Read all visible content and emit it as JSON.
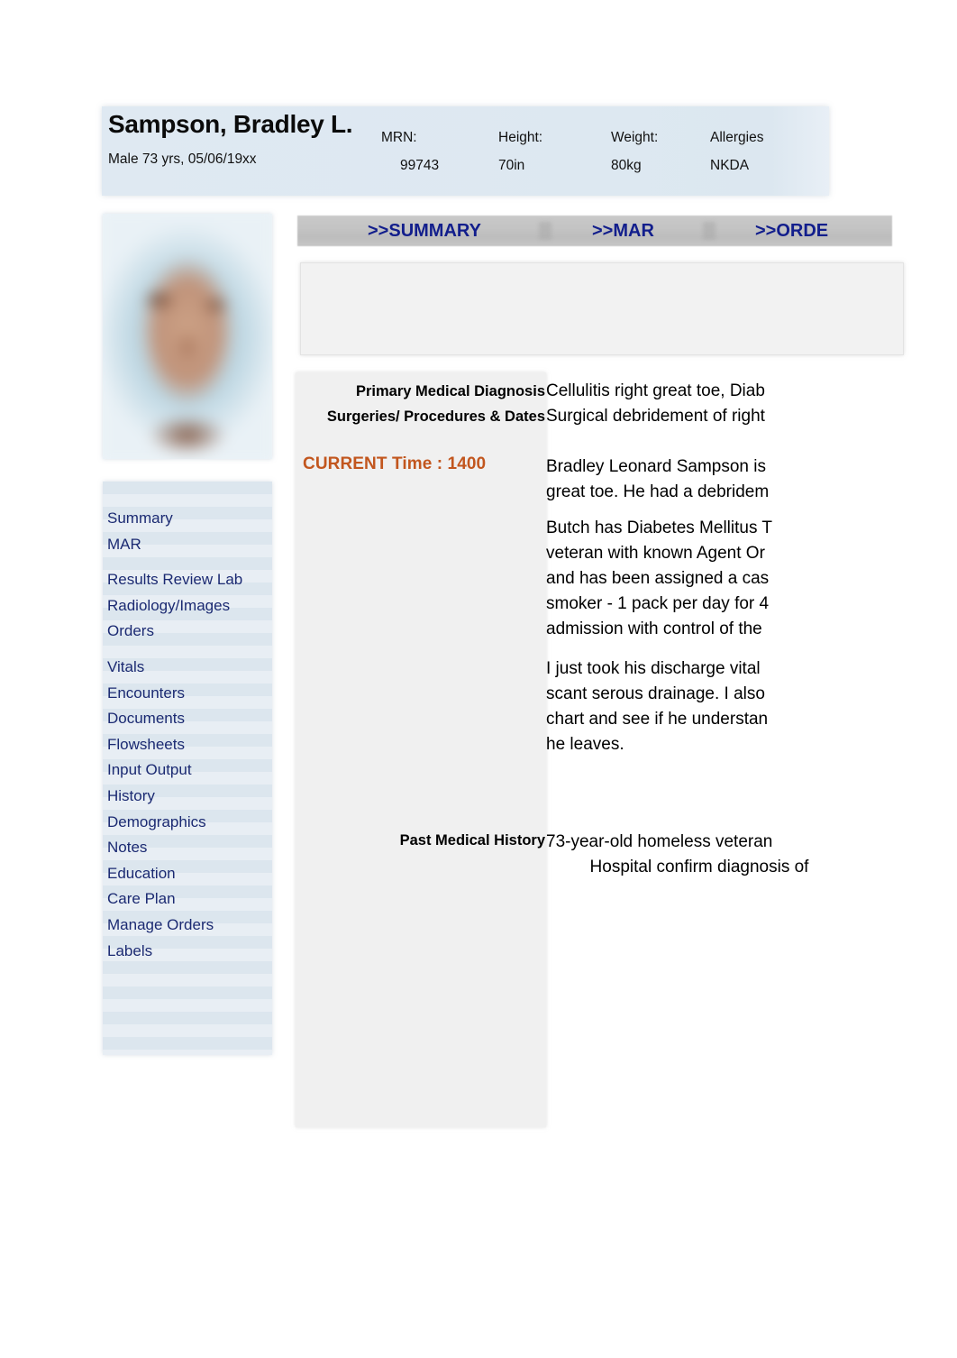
{
  "patient_header": {
    "name": "Sampson, Bradley L.",
    "demographics": "Male 73 yrs, 05/06/19xx",
    "mrn_label": "MRN:",
    "mrn_value": "99743",
    "height_label": "Height:",
    "height_value": "70in",
    "weight_label": "Weight:",
    "weight_value": "80kg",
    "allergies_label": "Allergies",
    "allergies_value": "NKDA"
  },
  "tabs": [
    {
      "label": ">>SUMMARY",
      "name": "tab-summary"
    },
    {
      "label": ">>MAR",
      "name": "tab-mar"
    },
    {
      "label": ">>ORDE",
      "name": "tab-orders"
    }
  ],
  "sidebar": {
    "items": [
      {
        "label": "Summary"
      },
      {
        "label": "MAR"
      },
      {
        "label": "Results Review Lab"
      },
      {
        "label": "Radiology/Images"
      },
      {
        "label": "Orders"
      },
      {
        "label": "Vitals"
      },
      {
        "label": "Encounters"
      },
      {
        "label": "Documents"
      },
      {
        "label": "Flowsheets"
      },
      {
        "label": "Input Output"
      },
      {
        "label": "History"
      },
      {
        "label": "Demographics"
      },
      {
        "label": "Notes"
      },
      {
        "label": "Education"
      },
      {
        "label": "Care Plan"
      },
      {
        "label": "Manage Orders"
      },
      {
        "label": "Labels"
      }
    ]
  },
  "content": {
    "primary_diagnosis_label": "Primary Medical Diagnosis",
    "primary_diagnosis_value": "Cellulitis right great toe, Diab",
    "surgeries_label": "Surgeries/ Procedures & Dates",
    "surgeries_value": "Surgical debridement of right",
    "current_time": "CURRENT Time : 1400",
    "narrative": {
      "paragraph_1": "Bradley Leonard Sampson is\ngreat toe. He had a debridem",
      "paragraph_2": "Butch has Diabetes Mellitus T\nveteran with known Agent Or\nand has been assigned a cas\nsmoker - 1 pack per day for 4\nadmission with control of the",
      "paragraph_3": "I just took his discharge vital\nscant serous drainage. I also\nchart and see if he understan\nhe leaves."
    },
    "past_medical_history_label": "Past Medical History",
    "past_medical_history_line_1": "73-year-old homeless veteran",
    "past_medical_history_line_2": "Hospital confirm diagnosis of"
  },
  "colors": {
    "header_banner": "#dce7f0",
    "sidebar_link": "#1b2a72",
    "tab_link": "#121e8c",
    "current_time_accent": "#c2561e",
    "content_panel": "#f0f0f0",
    "tab_bar": "#c4c4c4"
  }
}
